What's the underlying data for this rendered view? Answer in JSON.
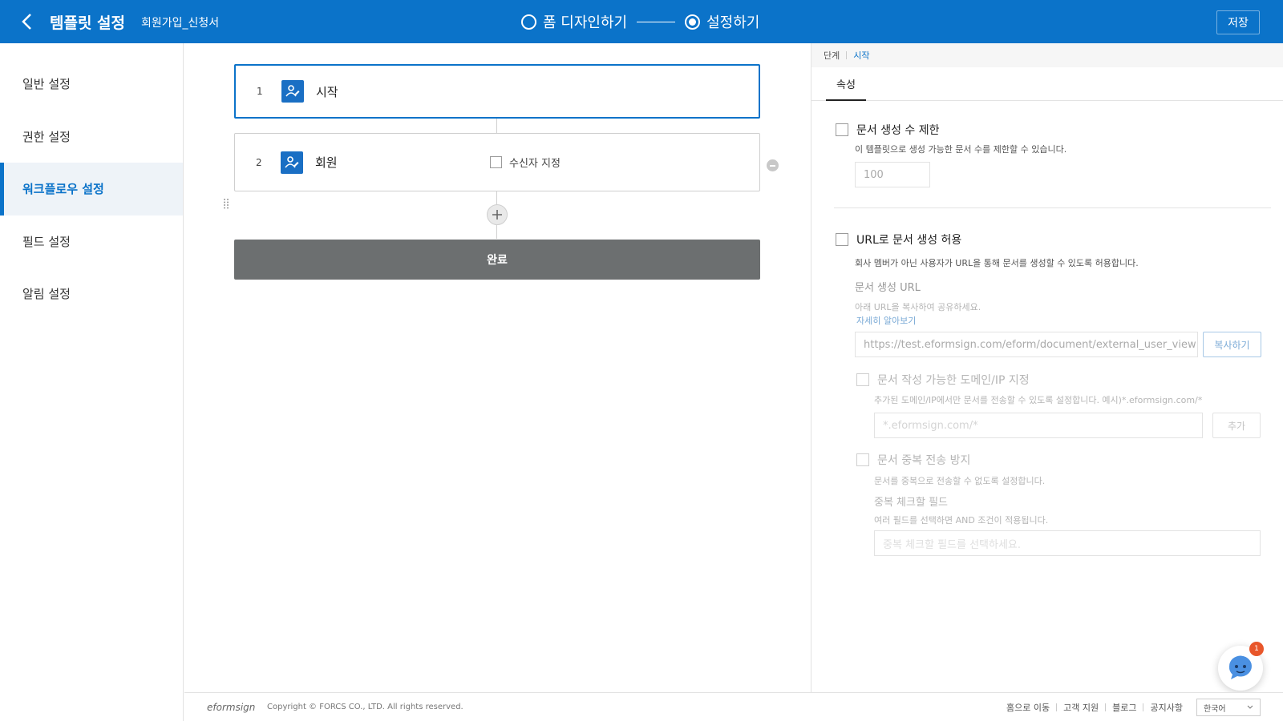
{
  "header": {
    "app_title": "템플릿 설정",
    "doc_name": "회원가입_신청서",
    "steps": [
      {
        "label": "폼 디자인하기",
        "active": false
      },
      {
        "label": "설정하기",
        "active": true
      }
    ],
    "save_label": "저장"
  },
  "sidebar": {
    "items": [
      {
        "label": "일반 설정"
      },
      {
        "label": "권한 설정"
      },
      {
        "label": "워크플로우 설정",
        "active": true
      },
      {
        "label": "필드 설정"
      },
      {
        "label": "알림 설정"
      }
    ]
  },
  "workflow": {
    "steps": [
      {
        "number": "1",
        "name": "시작",
        "icon": "user-edit-icon"
      },
      {
        "number": "2",
        "name": "회원",
        "icon": "user-edit-icon",
        "recipient_label": "수신자 지정"
      }
    ],
    "complete_label": "완료"
  },
  "panel": {
    "crumb_parent": "단계",
    "crumb_current": "시작",
    "tab": "속성",
    "limit": {
      "label": "문서 생성 수 제한",
      "desc": "이 템플릿으로 생성 가능한 문서 수를 제한할 수 있습니다.",
      "value": "100"
    },
    "url": {
      "label": "URL로 문서 생성 허용",
      "desc": "회사 멤버가 아닌 사용자가 URL을 통해 문서를 생성할 수 있도록 허용합니다.",
      "sub_label": "문서 생성 URL",
      "sub_desc": "아래 URL을 복사하여 공유하세요.",
      "link": "자세히 알아보기",
      "value": "https://test.eformsign.com/eform/document/external_user_view…",
      "copy_label": "복사하기"
    },
    "domain": {
      "label": "문서 작성 가능한 도메인/IP 지정",
      "desc": "추가된 도메인/IP에서만 문서를 전송할 수 있도록 설정합니다. 예시)*.eformsign.com/*",
      "placeholder": "*.eformsign.com/*",
      "add_label": "추가"
    },
    "dup": {
      "label": "문서 중복 전송 방지",
      "desc": "문서를 중복으로 전송할 수 없도록 설정합니다.",
      "field_label": "중복 체크할 필드",
      "field_desc": "여러 필드를 선택하면 AND 조건이 적용됩니다.",
      "placeholder": "중복 체크할 필드를 선택하세요."
    }
  },
  "chat": {
    "badge": "1"
  },
  "footer": {
    "logo": "eformsign",
    "copyright": "Copyright © FORCS CO., LTD. All rights reserved.",
    "links": [
      "홈으로 이동",
      "고객 지원",
      "블로그",
      "공지사항"
    ],
    "language": "한국어"
  },
  "colors": {
    "primary": "#0b73c9",
    "complete_bar": "#6c6f70"
  }
}
